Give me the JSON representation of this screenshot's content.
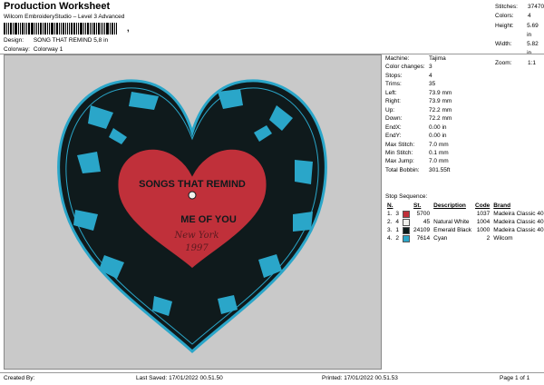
{
  "header": {
    "title": "Production Worksheet",
    "subtitle": "Wilcom EmbroideryStudio – Level 3 Advanced",
    "design_label": "Design:",
    "design_value": "SONG THAT REMIND 5,8 in",
    "colorway_label": "Colorway:",
    "colorway_value": "Colorway 1"
  },
  "stats": [
    {
      "label": "Stitches:",
      "value": "37470"
    },
    {
      "label": "Colors:",
      "value": "4"
    },
    {
      "label": "Height:",
      "value": "5.69 in"
    },
    {
      "label": "Width:",
      "value": "5.82 in"
    },
    {
      "label": "Zoom:",
      "value": "1:1"
    }
  ],
  "info": [
    {
      "label": "Machine:",
      "value": "Tajima"
    },
    {
      "label": "Color changes:",
      "value": "3"
    },
    {
      "label": "Stops:",
      "value": "4"
    },
    {
      "label": "Trims:",
      "value": "35"
    },
    {
      "label": "Left:",
      "value": "73.9 mm"
    },
    {
      "label": "Right:",
      "value": "73.9 mm"
    },
    {
      "label": "Up:",
      "value": "72.2 mm"
    },
    {
      "label": "Down:",
      "value": "72.2 mm"
    },
    {
      "label": "EndX:",
      "value": "0.00 in"
    },
    {
      "label": "EndY:",
      "value": "0.00 in"
    },
    {
      "label": "Max Stitch:",
      "value": "7.0 mm"
    },
    {
      "label": "Min Stitch:",
      "value": "0.1 mm"
    },
    {
      "label": "Max Jump:",
      "value": "7.0 mm"
    },
    {
      "label": "Total Bobbin:",
      "value": "301.55ft"
    }
  ],
  "stop_sequence": {
    "title": "Stop Sequence:",
    "headers": {
      "n": "N.",
      "st": "St.",
      "desc": "Description",
      "code": "Code",
      "brand": "Brand"
    },
    "rows": [
      {
        "idx": "1.",
        "n": "3",
        "color": "#c0303a",
        "st": "5700",
        "desc": "",
        "code": "1037",
        "brand": "Madeira Classic 40"
      },
      {
        "idx": "2.",
        "n": "4",
        "color": "#f2f2ee",
        "st": "45",
        "desc": "Natural White",
        "code": "1004",
        "brand": "Madeira Classic 40"
      },
      {
        "idx": "3.",
        "n": "1",
        "color": "#0c1a1a",
        "st": "24109",
        "desc": "Emerald Black",
        "code": "1000",
        "brand": "Madeira Classic 40"
      },
      {
        "idx": "4.",
        "n": "2",
        "color": "#2aa6c9",
        "st": "7614",
        "desc": "Cyan",
        "code": "2",
        "brand": "Wilcom"
      }
    ]
  },
  "design_text": {
    "line1": "SONGS THAT REMIND",
    "line2": "ME OF YOU",
    "line3": "New York",
    "line4": "1997"
  },
  "colors": {
    "background": "#c9c9c9",
    "heart_black": "#0f1a1c",
    "cyan": "#2aa6c9",
    "label_red": "#c0303a"
  },
  "footer": {
    "created_by": "Created By:",
    "last_saved": "Last Saved: 17/01/2022 00.51.50",
    "printed": "Printed: 17/01/2022 00.51.53",
    "page": "Page 1 of 1"
  }
}
